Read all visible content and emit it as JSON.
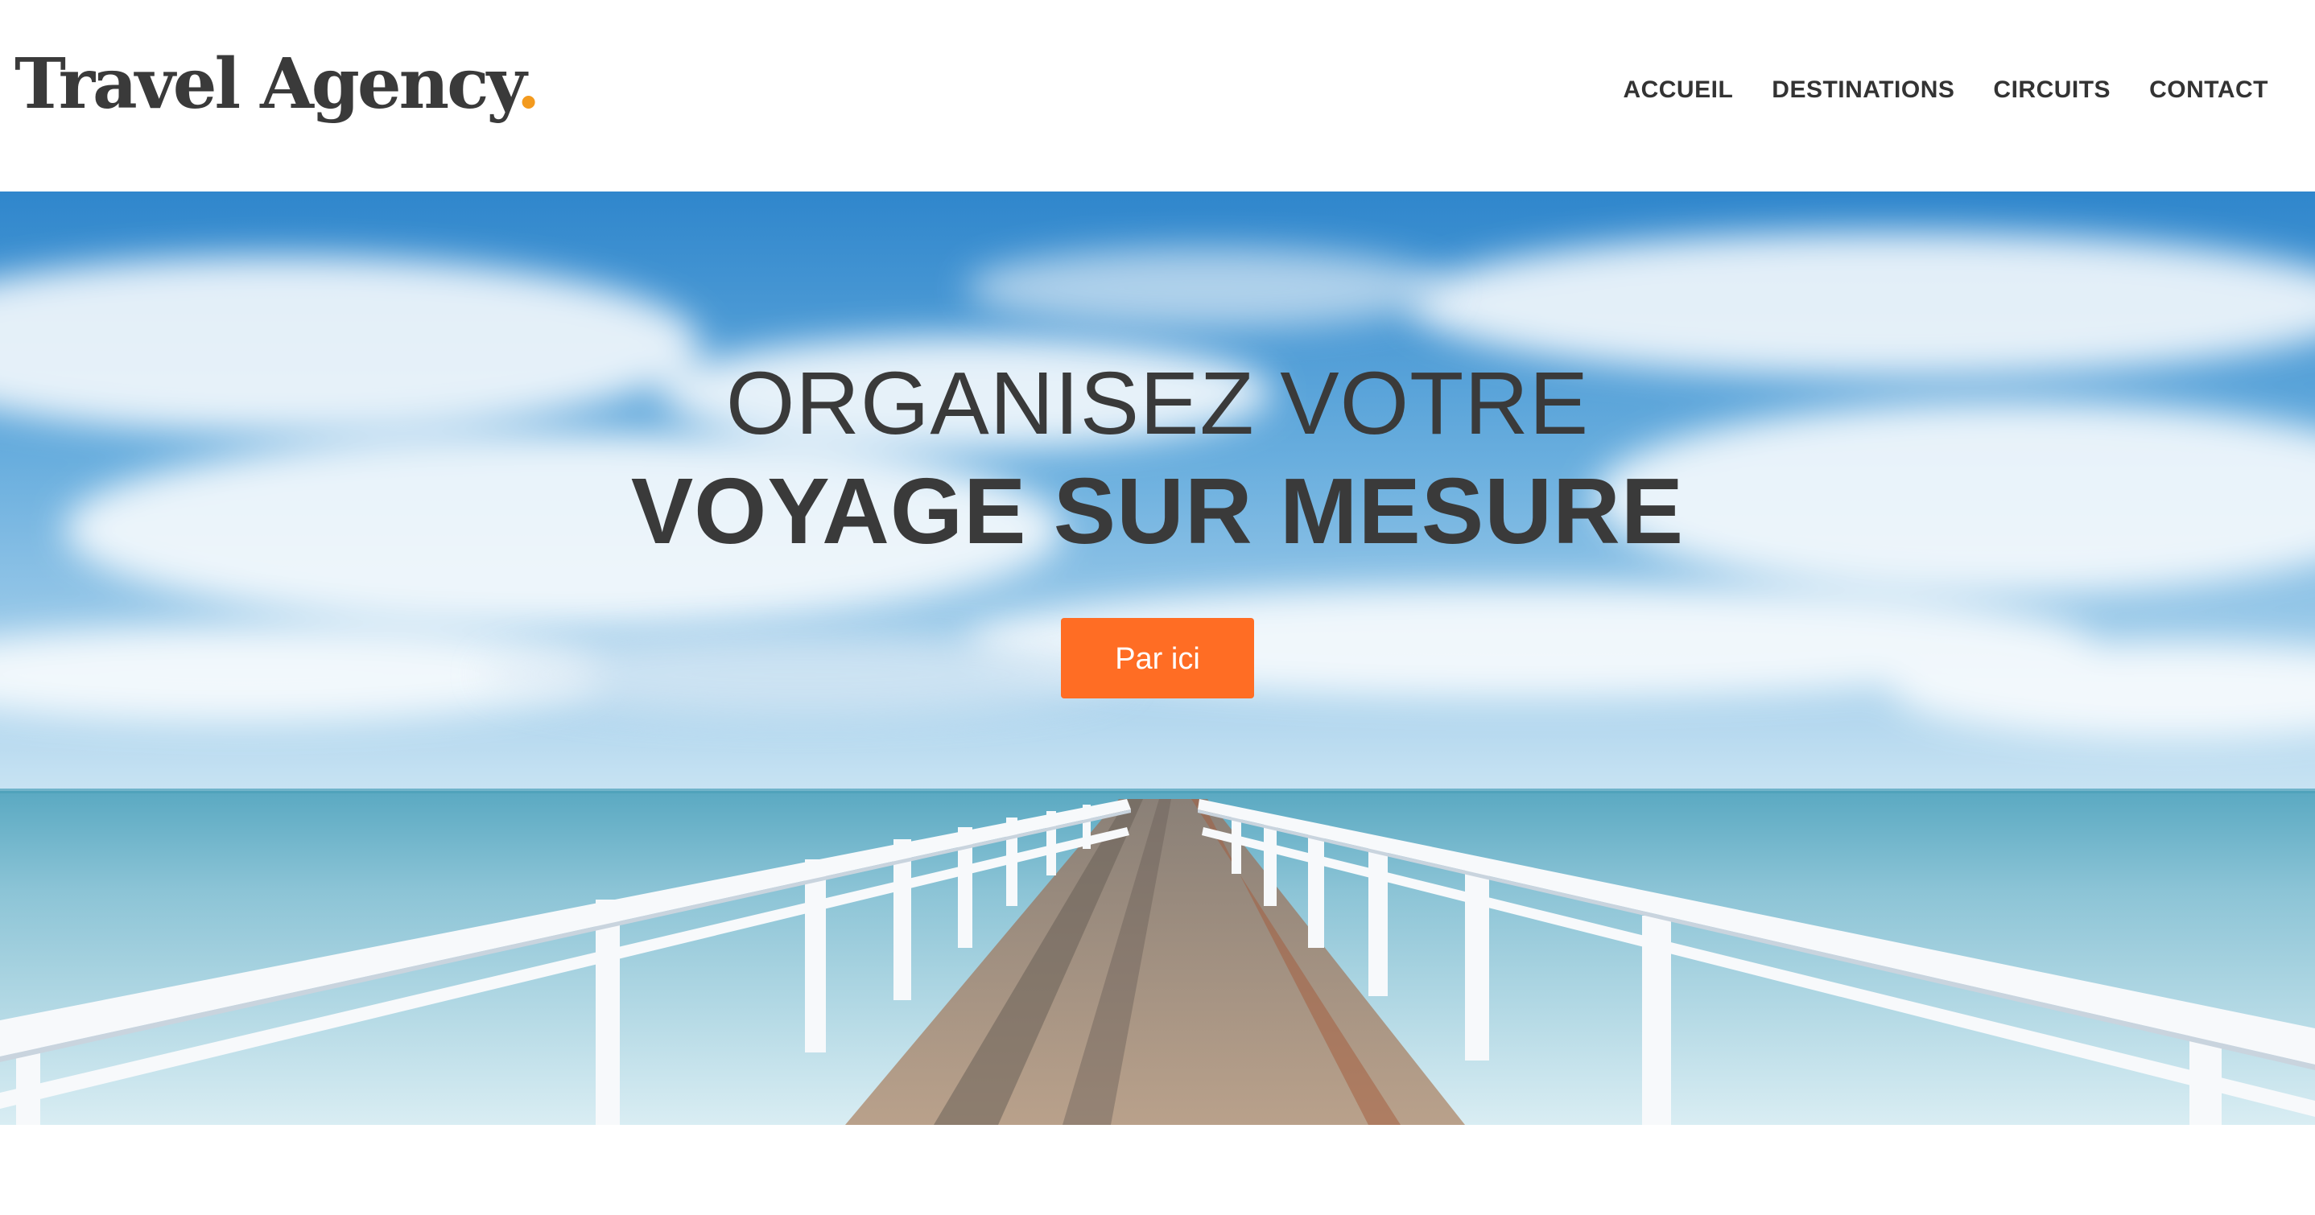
{
  "brand": {
    "name": "Travel Agency",
    "dot": ".",
    "dot_color": "#f39a1e"
  },
  "nav": {
    "items": [
      {
        "label": "ACCUEIL"
      },
      {
        "label": "DESTINATIONS"
      },
      {
        "label": "CIRCUITS"
      },
      {
        "label": "CONTACT"
      }
    ]
  },
  "hero": {
    "title_line1": "ORGANISEZ VOTRE",
    "title_line2": "VOYAGE SUR MESURE",
    "cta_label": "Par ici",
    "cta_color": "#ff6d24",
    "background": "sky-sea-pier-photo"
  }
}
